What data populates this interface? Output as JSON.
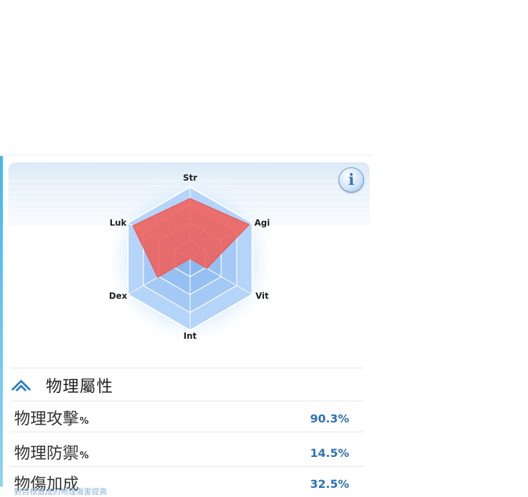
{
  "radar": {
    "axes": [
      "Str",
      "Agi",
      "Vit",
      "Int",
      "Dex",
      "Luk"
    ],
    "values": [
      0.84,
      0.95,
      0.27,
      0.0,
      0.52,
      0.92
    ]
  },
  "section": {
    "title": "物理屬性"
  },
  "stats": [
    {
      "name": "物理攻擊",
      "unit": "%",
      "value": "90.3%"
    },
    {
      "name": "物理防禦",
      "unit": "%",
      "value": "14.5%"
    },
    {
      "name": "物傷加成",
      "unit": "",
      "value": "32.5%",
      "subtitle": "對目標造成的物理傷害提高"
    }
  ],
  "colors": {
    "accent": "#2c72b8",
    "radar_fill": "#f0605a",
    "radar_bg": "#a9cdf6"
  }
}
